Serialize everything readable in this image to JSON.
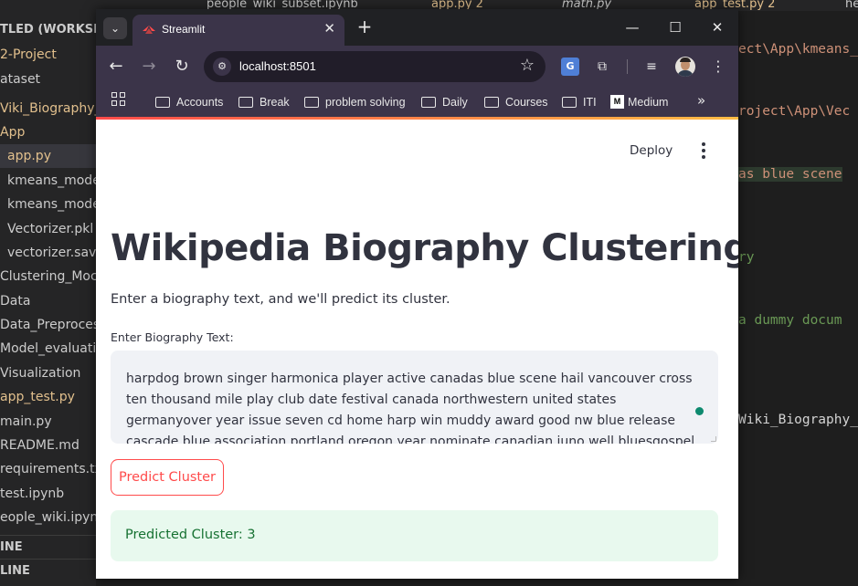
{
  "vscode": {
    "tabs": [
      {
        "label": "people_wiki_subset.ipynb",
        "modified": false,
        "italic": false
      },
      {
        "label": "app.py  2",
        "modified": true,
        "italic": false
      },
      {
        "label": "math.py",
        "modified": false,
        "italic": true
      },
      {
        "label": "app_test.py  2",
        "modified": true,
        "italic": false
      },
      {
        "label": "he",
        "modified": false,
        "italic": false
      }
    ],
    "explorer": {
      "workspace_title": "TLED (WORKSPAC",
      "items": [
        "2-Project",
        "ataset",
        "Viki_Biography_C",
        "App",
        "app.py",
        "kmeans_mode",
        "kmeans_mode",
        "Vectorizer.pkl",
        "vectorizer.sav",
        "Clustering_Moc",
        "Data",
        "Data_Preproces",
        "Model_evaluati",
        "Visualization",
        "app_test.py",
        "main.py",
        "README.md",
        "requirements.tx",
        "test.ipynb",
        "eople_wiki.ipyn"
      ],
      "sections": [
        "INE",
        "LINE"
      ]
    },
    "editor_lines": [
      "ect\\App\\kmeans_",
      "roject\\App\\Vec",
      "as blue scene",
      "ry",
      "a dummy docum",
      "Wiki_Biography_"
    ]
  },
  "browser": {
    "tab_title": "Streamlit",
    "url": "localhost:8501",
    "bookmarks": [
      "Accounts",
      "Break",
      "problem solving",
      "Daily",
      "Courses",
      "ITI",
      "Medium"
    ],
    "translate_label": "G"
  },
  "app": {
    "deploy_label": "Deploy",
    "title": "Wikipedia Biography Clustering",
    "subtitle": "Enter a biography text, and we'll predict its cluster.",
    "textarea_label": "Enter Biography Text:",
    "textarea_value": "harpdog brown singer harmonica player active canadas blue scene   hail vancouver cross ten thousand mile play club date festival canada northwestern united states germanyover year issue seven cd   home harp win muddy award good nw blue release cascade blue association portland oregon year nominate canadian juno well bluesgospel recording team graham guest",
    "button_label": "Predict Cluster",
    "result_text": "Predicted Cluster: 3"
  }
}
